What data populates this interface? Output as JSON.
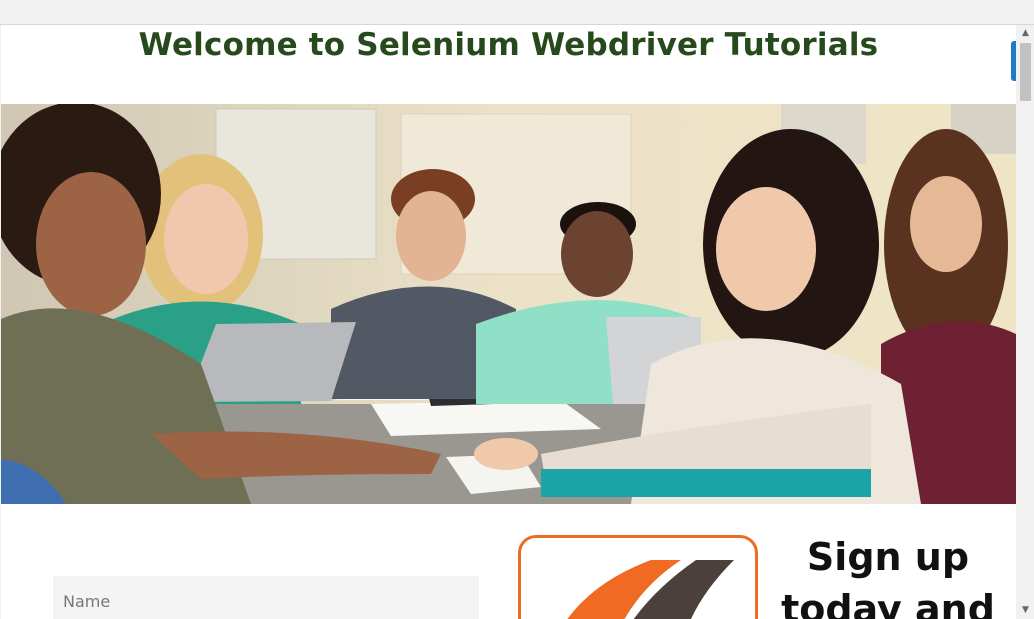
{
  "page": {
    "title": "Welcome to Selenium Webdriver Tutorials"
  },
  "form": {
    "name_placeholder": "Name"
  },
  "signup": {
    "line1": "Sign up",
    "line2": "today and"
  },
  "scrollbar": {
    "up_glyph": "▲",
    "down_glyph": "▼"
  },
  "colors": {
    "title": "#264a1c",
    "accent_orange": "#ee6c22",
    "accent_blue": "#1e7bc4"
  }
}
